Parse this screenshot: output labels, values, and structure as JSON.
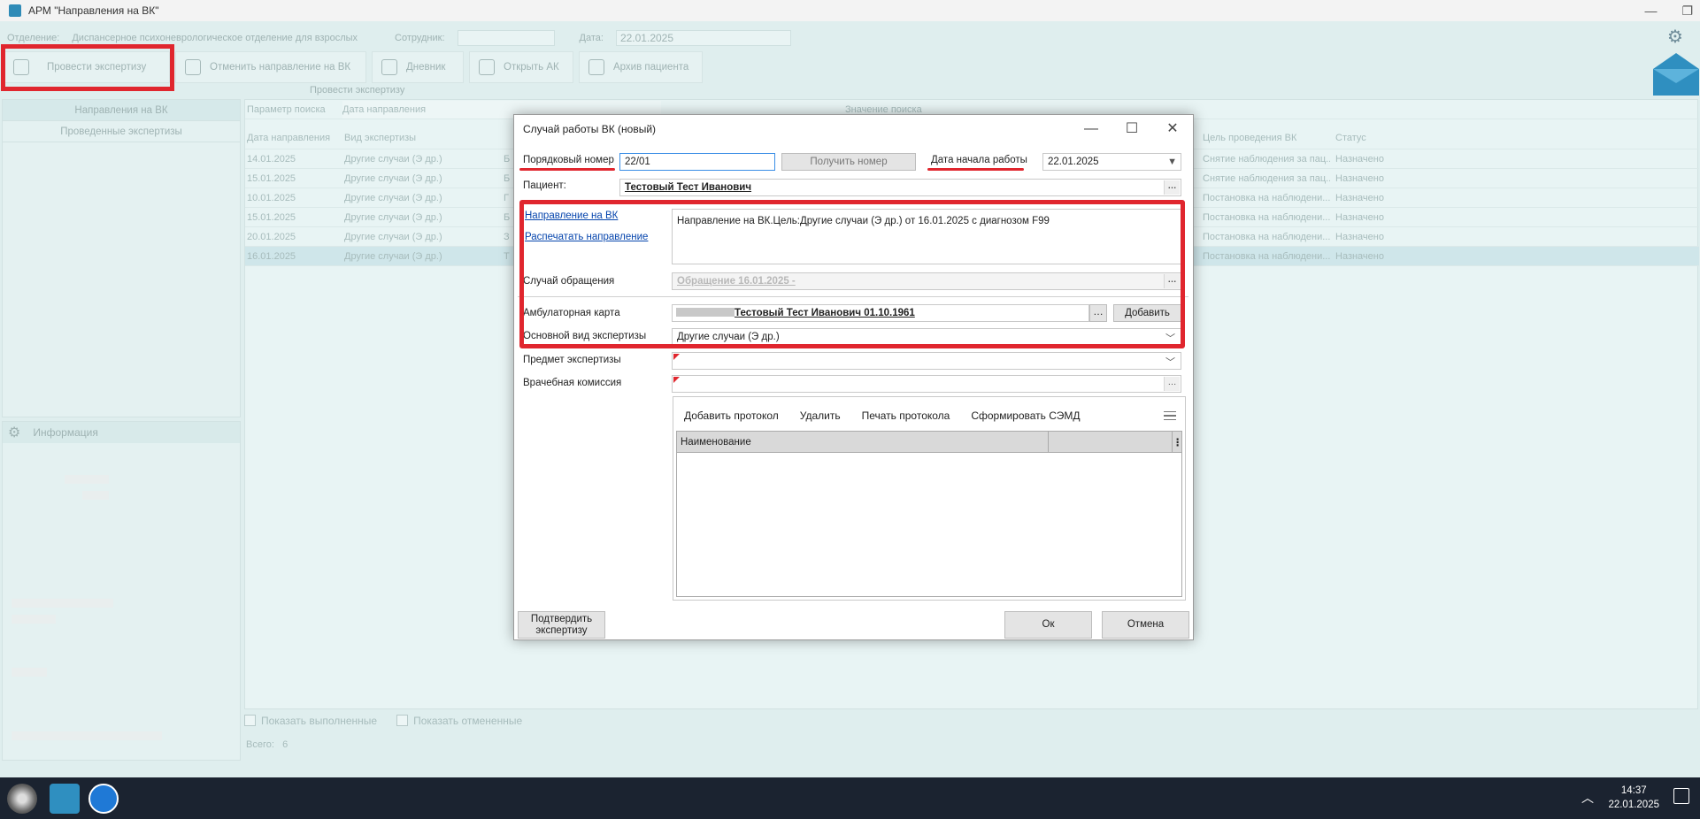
{
  "app": {
    "title": "АРМ \"Направления на ВК\"",
    "filter": {
      "department_label": "Отделение:",
      "department_value": "Диспансерное психоневрологическое отделение для взрослых",
      "employee_label": "Сотрудник:",
      "date_label": "Дата:",
      "date_value": "22.01.2025"
    },
    "toolbar": {
      "conduct": "Провести экспертизу",
      "cancel": "Отменить направление на ВК",
      "diary": "Дневник",
      "open_ak": "Открыть АК",
      "archive": "Архив пациента",
      "caption": "Провести экспертизу"
    },
    "left_tabs": [
      "Направления на ВК",
      "Проведенные экспертизы"
    ],
    "info_title": "Информация",
    "search": {
      "param_label": "Параметр поиска",
      "param_value": "Дата направления",
      "value_label": "Значение поиска"
    },
    "grid": {
      "columns": [
        "Дата направления",
        "Вид экспертизы",
        "Цель проведения ВК",
        "Статус"
      ],
      "rows": [
        {
          "date": "14.01.2025",
          "kind": "Другие случаи (Э др.)",
          "extra": "Б",
          "goal": "Снятие наблюдения за пац...",
          "status": "Назначено"
        },
        {
          "date": "15.01.2025",
          "kind": "Другие случаи (Э др.)",
          "extra": "Б",
          "goal": "Снятие наблюдения за пац...",
          "status": "Назначено"
        },
        {
          "date": "10.01.2025",
          "kind": "Другие случаи (Э др.)",
          "extra": "Г",
          "goal": "Постановка на наблюдени...",
          "status": "Назначено"
        },
        {
          "date": "15.01.2025",
          "kind": "Другие случаи (Э др.)",
          "extra": "Б",
          "goal": "Постановка на наблюдени...",
          "status": "Назначено"
        },
        {
          "date": "20.01.2025",
          "kind": "Другие случаи (Э др.)",
          "extra": "З",
          "goal": "Постановка на наблюдени...",
          "status": "Назначено"
        },
        {
          "date": "16.01.2025",
          "kind": "Другие случаи (Э др.)",
          "extra": "Т",
          "goal": "Постановка на наблюдени...",
          "status": "Назначено"
        }
      ],
      "show_done": "Показать выполненные",
      "show_cancelled": "Показать отмененные",
      "total_label": "Всего:",
      "total_value": "6"
    }
  },
  "dialog": {
    "title": "Случай работы ВК (новый)",
    "order_label": "Порядковый номер",
    "order_value": "22/01",
    "get_number": "Получить номер",
    "start_date_label": "Дата начала работы",
    "start_date_value": "22.01.2025",
    "patient_label": "Пациент:",
    "patient_value": "Тестовый Тест Иванович",
    "referral_link": "Направление на ВК",
    "print_link": "Распечатать направление",
    "referral_text": "Направление на ВК.Цель:Другие случаи (Э др.) от 16.01.2025 с диагнозом F99",
    "visit_label": "Случай обращения",
    "visit_value": "Обращение 16.01.2025 -",
    "card_label": "Амбулаторная карта",
    "card_value": "Тестовый Тест Иванович 01.10.1961",
    "add": "Добавить",
    "exam_type_label": "Основной вид экспертизы",
    "exam_type_value": "Другие случаи (Э др.)",
    "subject_label": "Предмет экспертизы",
    "commission_label": "Врачебная комиссия",
    "protocol": {
      "add": "Добавить протокол",
      "delete": "Удалить",
      "print": "Печать протокола",
      "semd": "Сформировать СЭМД",
      "col_name": "Наименование"
    },
    "confirm": "Подтвердить экспертизу",
    "ok": "Ок",
    "cancel": "Отмена"
  },
  "taskbar": {
    "time": "14:37",
    "date": "22.01.2025"
  },
  "colors": {
    "highlight": "#e0262e",
    "link": "#0645ad",
    "taskbar": "#1b2330"
  }
}
